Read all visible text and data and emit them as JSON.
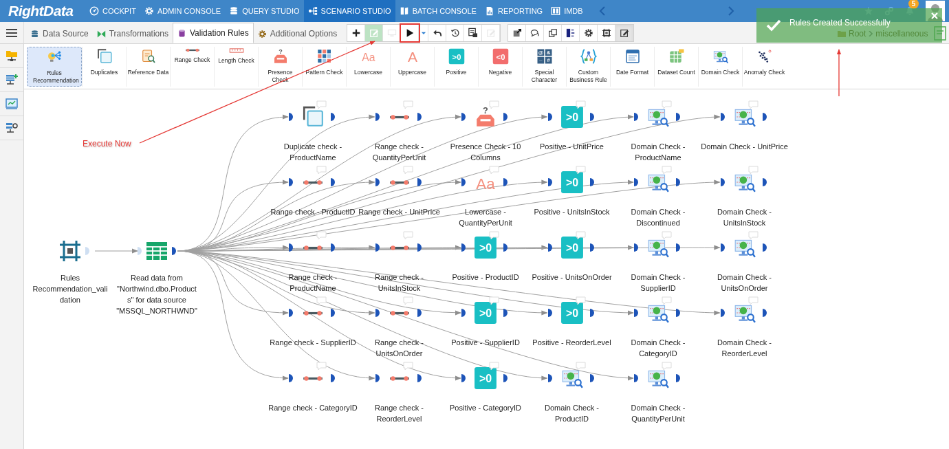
{
  "nav": {
    "logo": "RightData",
    "items": [
      {
        "label": "COCKPIT",
        "kind": "gauge",
        "selected": false
      },
      {
        "label": "ADMIN CONSOLE",
        "kind": "gear",
        "selected": false
      },
      {
        "label": "QUERY STUDIO",
        "kind": "database",
        "selected": false
      },
      {
        "label": "SCENARIO STUDIO",
        "kind": "flow",
        "selected": true
      },
      {
        "label": "BATCH CONSOLE",
        "kind": "book",
        "selected": false
      },
      {
        "label": "REPORTING",
        "kind": "report",
        "selected": false
      },
      {
        "label": "IMDB",
        "kind": "columns",
        "selected": false
      }
    ],
    "notification_count": "5"
  },
  "tabs": [
    {
      "label": "Data Source",
      "kind": "database",
      "selected": false
    },
    {
      "label": "Transformations",
      "kind": "bowtie",
      "selected": false
    },
    {
      "label": "Validation Rules",
      "kind": "cylinder",
      "selected": true
    },
    {
      "label": "Additional Options",
      "kind": "gear",
      "selected": false
    }
  ],
  "toolbar_groups": [
    [
      {
        "kind": "plus",
        "disabled": false,
        "highlighted": false,
        "pressed": false
      },
      {
        "kind": "edit-green",
        "disabled": true,
        "highlighted": false,
        "pressed": false
      },
      {
        "kind": "monitor",
        "disabled": true,
        "highlighted": false,
        "pressed": false
      },
      {
        "kind": "play",
        "disabled": false,
        "highlighted": true,
        "pressed": false
      },
      {
        "kind": "caret",
        "disabled": false,
        "highlighted": false,
        "pressed": false
      },
      {
        "kind": "undo",
        "disabled": false,
        "highlighted": false,
        "pressed": false
      },
      {
        "kind": "history",
        "disabled": false,
        "highlighted": false,
        "pressed": false
      },
      {
        "kind": "report",
        "disabled": false,
        "highlighted": false,
        "pressed": false
      },
      {
        "kind": "edit",
        "disabled": true,
        "highlighted": false,
        "pressed": false
      }
    ],
    [
      {
        "kind": "expand",
        "disabled": false,
        "highlighted": false,
        "pressed": false
      },
      {
        "kind": "chat",
        "disabled": false,
        "highlighted": false,
        "pressed": false
      },
      {
        "kind": "copy",
        "disabled": false,
        "highlighted": false,
        "pressed": false
      },
      {
        "kind": "tree",
        "disabled": false,
        "highlighted": false,
        "pressed": false
      },
      {
        "kind": "gear",
        "disabled": false,
        "highlighted": false,
        "pressed": false
      },
      {
        "kind": "frame",
        "disabled": false,
        "highlighted": false,
        "pressed": false
      },
      {
        "kind": "edit",
        "disabled": false,
        "highlighted": false,
        "pressed": true
      }
    ]
  ],
  "breadcrumb": [
    "Root",
    "miscellaneous"
  ],
  "toast": {
    "message": "Rules Created Successfully"
  },
  "palette": [
    {
      "label": "Rules Recommendation",
      "kind": "recommendation",
      "selected": true
    },
    {
      "label": "Duplicates",
      "kind": "duplicates",
      "selected": false
    },
    {
      "label": "Reference Data",
      "kind": "reference",
      "selected": false
    },
    {
      "label": "Range Check",
      "kind": "range",
      "selected": false
    },
    {
      "label": "Length Check",
      "kind": "length",
      "selected": false
    },
    {
      "label": "Presence Check",
      "kind": "presence",
      "glyph": "?",
      "selected": false
    },
    {
      "label": "Pattern Check",
      "kind": "pattern",
      "selected": false
    },
    {
      "label": "Lowercase",
      "kind": "lowercase",
      "glyph": "Aa",
      "selected": false
    },
    {
      "label": "Uppercase",
      "kind": "uppercase",
      "glyph": "A",
      "selected": false
    },
    {
      "label": "Positive",
      "kind": "positive",
      "glyph": ">0",
      "selected": false
    },
    {
      "label": "Negative",
      "kind": "negative",
      "glyph": "<0",
      "selected": false
    },
    {
      "label": "Special Character",
      "kind": "special",
      "glyph": [
        "@",
        "&",
        "_",
        "#"
      ],
      "selected": false
    },
    {
      "label": "Custom Business Rule",
      "kind": "custom",
      "selected": false
    },
    {
      "label": "Date Format",
      "kind": "date",
      "selected": false
    },
    {
      "label": "Dataset Count",
      "kind": "count",
      "selected": false
    },
    {
      "label": "Domain Check",
      "kind": "domain",
      "selected": false
    },
    {
      "label": "Anomaly Check",
      "kind": "anomaly",
      "selected": false
    }
  ],
  "annotation": {
    "text": "Execute Now"
  },
  "source_nodes": [
    {
      "label": "Rules Recommendation_validation",
      "kind": "frame"
    },
    {
      "label": "Read data from \"Northwind.dbo.Products\" for data source \"MSSQL_NORTHWND\"",
      "kind": "table"
    }
  ],
  "rule_rows": [
    [
      {
        "label": "Duplicate check - ProductName",
        "kind": "duplicates"
      },
      {
        "label": "Range check - QuantityPerUnit",
        "kind": "range"
      },
      {
        "label": "Presence Check - 10 Columns",
        "kind": "presence",
        "glyph": "?"
      },
      {
        "label": "Positive - UnitPrice",
        "kind": "positive",
        "glyph": ">0"
      },
      {
        "label": "Domain Check - ProductName",
        "kind": "domain"
      },
      {
        "label": "Domain Check - UnitPrice",
        "kind": "domain"
      }
    ],
    [
      {
        "label": "Range check - ProductID",
        "kind": "range"
      },
      {
        "label": "Range check - UnitPrice",
        "kind": "range"
      },
      {
        "label": "Lowercase - QuantityPerUnit",
        "kind": "lowercase",
        "glyph": "Aa"
      },
      {
        "label": "Positive - UnitsInStock",
        "kind": "positive",
        "glyph": ">0"
      },
      {
        "label": "Domain Check - Discontinued",
        "kind": "domain"
      },
      {
        "label": "Domain Check - UnitsInStock",
        "kind": "domain"
      }
    ],
    [
      {
        "label": "Range check - ProductName",
        "kind": "range"
      },
      {
        "label": "Range check - UnitsInStock",
        "kind": "range"
      },
      {
        "label": "Positive - ProductID",
        "kind": "positive",
        "glyph": ">0"
      },
      {
        "label": "Positive - UnitsOnOrder",
        "kind": "positive",
        "glyph": ">0"
      },
      {
        "label": "Domain Check - SupplierID",
        "kind": "domain"
      },
      {
        "label": "Domain Check - UnitsOnOrder",
        "kind": "domain"
      }
    ],
    [
      {
        "label": "Range check - SupplierID",
        "kind": "range"
      },
      {
        "label": "Range check - UnitsOnOrder",
        "kind": "range"
      },
      {
        "label": "Positive - SupplierID",
        "kind": "positive",
        "glyph": ">0"
      },
      {
        "label": "Positive - ReorderLevel",
        "kind": "positive",
        "glyph": ">0"
      },
      {
        "label": "Domain Check - CategoryID",
        "kind": "domain"
      },
      {
        "label": "Domain Check - ReorderLevel",
        "kind": "domain"
      }
    ],
    [
      {
        "label": "Range check - CategoryID",
        "kind": "range"
      },
      {
        "label": "Range check - ReorderLevel",
        "kind": "range"
      },
      {
        "label": "Positive - CategoryID",
        "kind": "positive",
        "glyph": ">0"
      },
      {
        "label": "Domain Check - ProductID",
        "kind": "domain"
      },
      {
        "label": "Domain Check - QuantityPerUnit",
        "kind": "domain"
      }
    ]
  ]
}
